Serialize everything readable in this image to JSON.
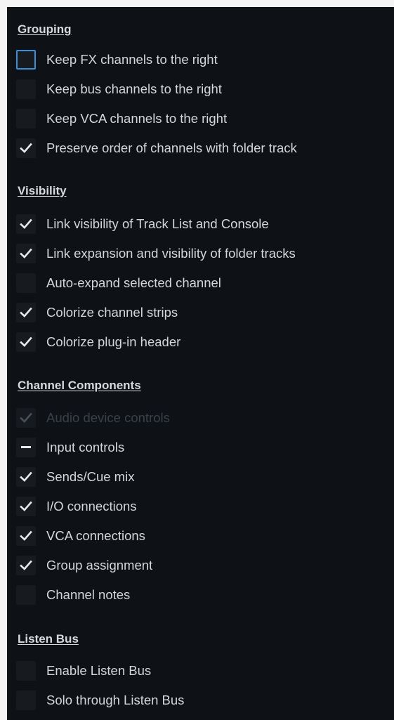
{
  "sections": {
    "grouping": {
      "title": "Grouping",
      "items": [
        {
          "label": "Keep FX channels to the right",
          "state": "unchecked",
          "focused": true
        },
        {
          "label": "Keep bus channels to the right",
          "state": "unchecked"
        },
        {
          "label": "Keep VCA channels to the right",
          "state": "unchecked"
        },
        {
          "label": "Preserve order of channels with folder track",
          "state": "checked"
        }
      ]
    },
    "visibility": {
      "title": "Visibility",
      "items": [
        {
          "label": "Link visibility of Track List and Console",
          "state": "checked"
        },
        {
          "label": "Link expansion and visibility of folder tracks",
          "state": "checked"
        },
        {
          "label": "Auto-expand selected channel",
          "state": "unchecked"
        },
        {
          "label": "Colorize channel strips",
          "state": "checked"
        },
        {
          "label": "Colorize plug-in header",
          "state": "checked"
        }
      ]
    },
    "channel_components": {
      "title": "Channel Components",
      "items": [
        {
          "label": "Audio device controls",
          "state": "checked",
          "disabled": true
        },
        {
          "label": "Input controls",
          "state": "indeterminate"
        },
        {
          "label": "Sends/Cue mix",
          "state": "checked"
        },
        {
          "label": "I/O connections",
          "state": "checked"
        },
        {
          "label": "VCA connections",
          "state": "checked"
        },
        {
          "label": "Group assignment",
          "state": "checked"
        },
        {
          "label": "Channel notes",
          "state": "unchecked"
        }
      ]
    },
    "listen_bus": {
      "title": "Listen Bus",
      "items": [
        {
          "label": "Enable Listen Bus",
          "state": "unchecked"
        },
        {
          "label": "Solo through Listen Bus",
          "state": "unchecked"
        }
      ]
    }
  }
}
